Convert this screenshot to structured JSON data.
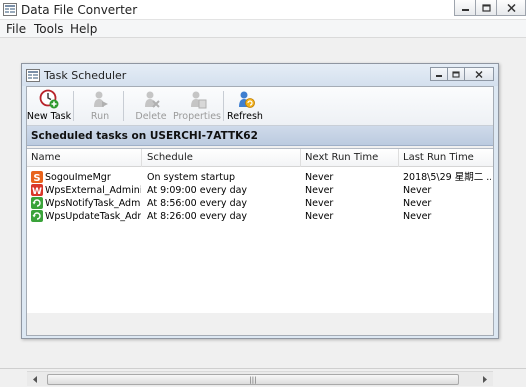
{
  "app": {
    "title": "Data File Converter",
    "menu": [
      "File",
      "Tools",
      "Help"
    ]
  },
  "scheduler": {
    "title": "Task Scheduler",
    "toolbar": {
      "new_task": "New Task",
      "run": "Run",
      "delete": "Delete",
      "properties": "Properties",
      "refresh": "Refresh"
    },
    "header": "Scheduled tasks on USERCHI-7ATTK62",
    "columns": [
      "Name",
      "Schedule",
      "Next Run Time",
      "Last Run Time"
    ],
    "rows": [
      {
        "name": "SogouImeMgr",
        "schedule": "On system startup",
        "next": "Never",
        "last": "2018\\5\\29 星期二 ...",
        "icon": "sogou-icon",
        "color": "#e8631c"
      },
      {
        "name": "WpsExternal_Administ...",
        "schedule": "At 9:09:00 every day",
        "next": "Never",
        "last": "Never",
        "icon": "wps-icon",
        "color": "#d9372a"
      },
      {
        "name": "WpsNotifyTask_Admini...",
        "schedule": "At 8:56:00 every day",
        "next": "Never",
        "last": "Never",
        "icon": "task-refresh-icon",
        "color": "#3aa33a"
      },
      {
        "name": "WpsUpdateTask_Admi...",
        "schedule": "At 8:26:00 every day",
        "next": "Never",
        "last": "Never",
        "icon": "task-refresh-icon",
        "color": "#3aa33a"
      }
    ]
  },
  "colors": {
    "header_band": "#c5d3e6",
    "window_frame": "#dde8f3"
  }
}
